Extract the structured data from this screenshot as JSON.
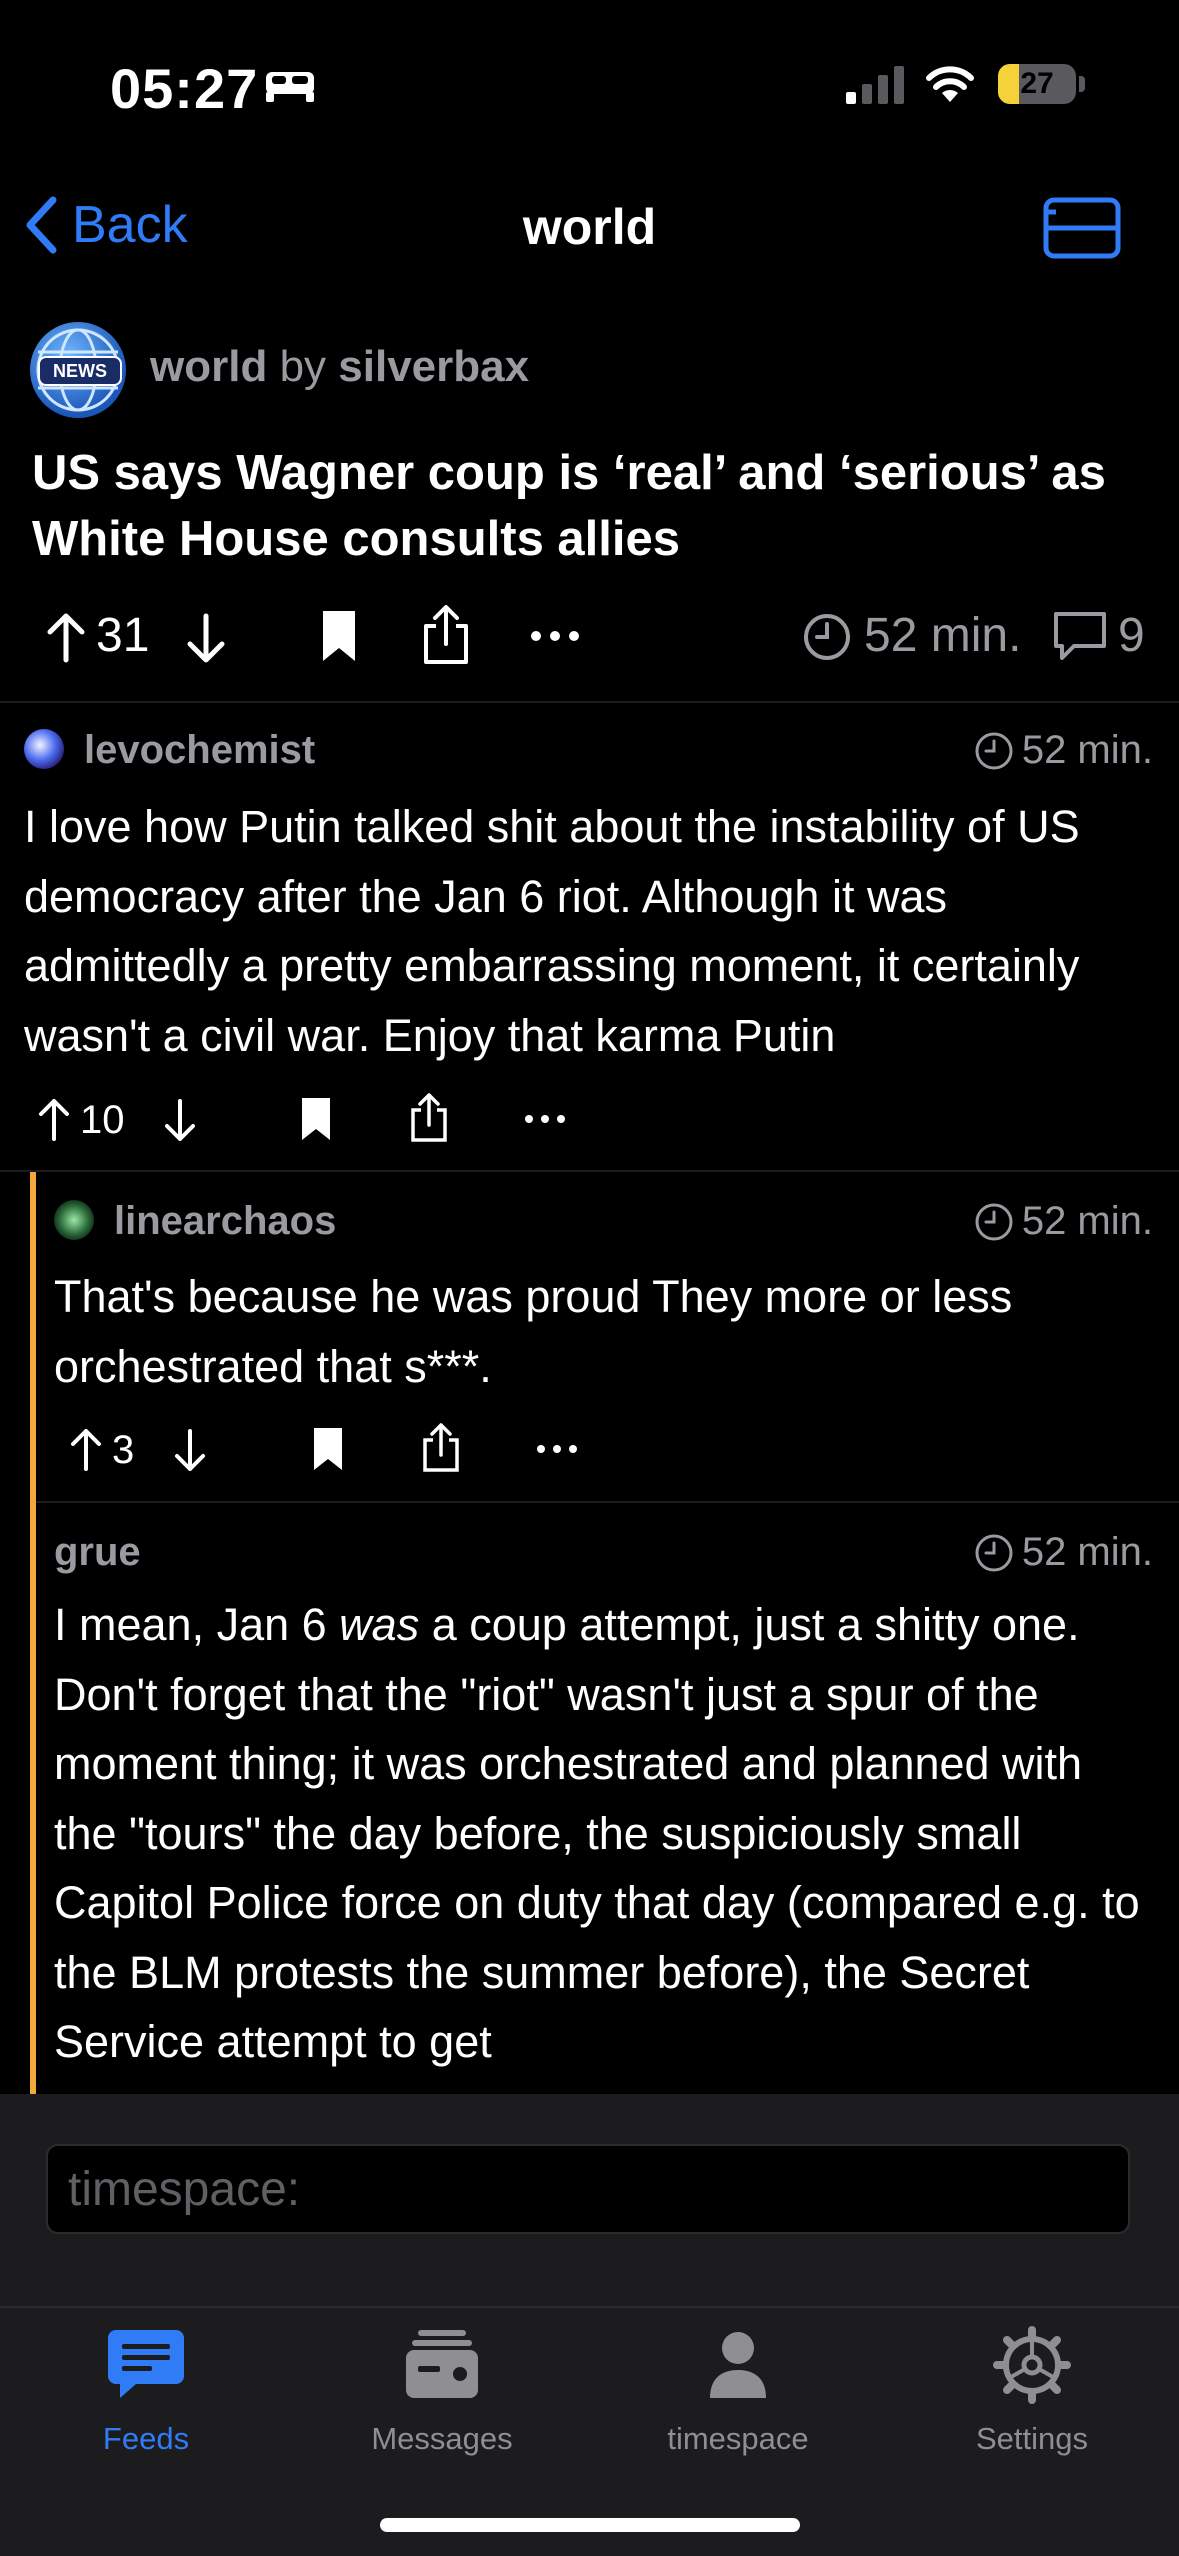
{
  "status_bar": {
    "time": "05:27",
    "battery": "27",
    "battery_level": 0.27
  },
  "nav": {
    "back_label": "Back",
    "title": "world"
  },
  "post": {
    "avatar_text": "NEWS",
    "community": "world",
    "by": "by",
    "author": "silverbax",
    "title": "US says Wagner coup is ‘real’ and ‘serious’ as White House consults allies",
    "score": "31",
    "time": "52 min.",
    "comments": "9"
  },
  "comments": [
    {
      "user": "levochemist",
      "time": "52 min.",
      "body": "I love how Putin talked shit about the instability of US democracy after the Jan 6 riot. Although it was admittedly a pretty embarrassing moment, it certainly wasn't a civil war. Enjoy that karma Putin",
      "score": "10"
    },
    {
      "user": "linearchaos",
      "time": "52 min.",
      "body": "That's because he was proud They more or less orchestrated that s***.",
      "score": "3"
    },
    {
      "user": "grue",
      "time": "52 min.",
      "body_before": "I mean, Jan 6 ",
      "body_emph": "was",
      "body_after": " a coup attempt, just a shitty one. Don't forget that the \"riot\" wasn't just a spur of the moment thing; it was orchestrated and planned with the \"tours\" the day before, the suspiciously small Capitol Police force on duty that day (compared e.g. to the BLM protests the summer before), the Secret Service attempt to get"
    }
  ],
  "composer": {
    "placeholder": "timespace:"
  },
  "tabs": [
    {
      "label": "Feeds",
      "icon": "feeds-icon",
      "active": true
    },
    {
      "label": "Messages",
      "icon": "messages-icon",
      "active": false
    },
    {
      "label": "timespace",
      "icon": "person-icon",
      "active": false
    },
    {
      "label": "Settings",
      "icon": "gear-icon",
      "active": false
    }
  ],
  "colors": {
    "accent": "#2f7cf6",
    "thread_bar": "#f2a83a",
    "secondary_text": "#9a9aa0",
    "background": "#000000"
  }
}
